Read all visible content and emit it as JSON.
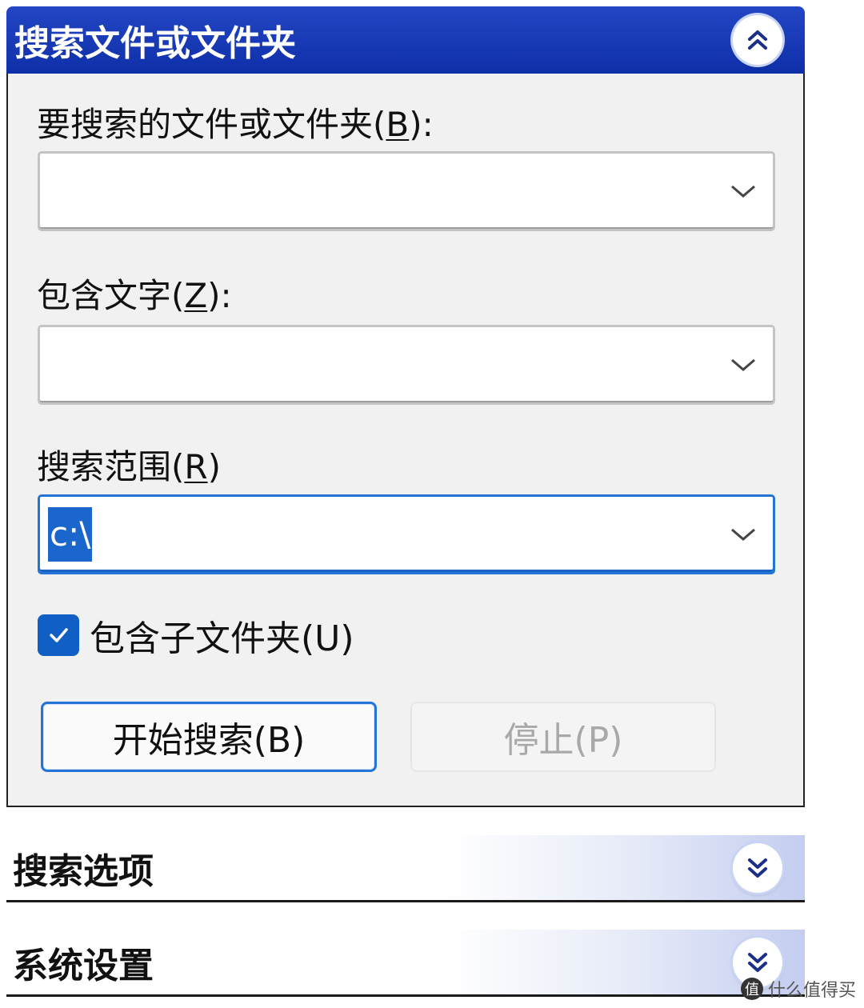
{
  "search_panel": {
    "title": "搜索文件或文件夹",
    "collapse_icon": "double-chevron-up-icon",
    "file_label": {
      "pre": "要搜索的文件或文件夹(",
      "key": "B",
      "post": "):"
    },
    "file_value": "",
    "text_label": {
      "pre": "包含文字(",
      "key": "Z",
      "post": "):"
    },
    "text_value": "",
    "scope_label": {
      "pre": "搜索范围(",
      "key": "R",
      "post": ")"
    },
    "scope_value": "c:\\",
    "subfolders_checked": true,
    "subfolders_label": "包含子文件夹(U)",
    "start_button": "开始搜索(B)",
    "stop_button": "停止(P)"
  },
  "options_panel": {
    "title": "搜索选项",
    "expand_icon": "double-chevron-down-icon"
  },
  "settings_panel": {
    "title": "系统设置",
    "expand_icon": "double-chevron-down-icon"
  },
  "watermark": {
    "text": "什么值得买",
    "badge": "值"
  },
  "colors": {
    "header_blue": "#0e2fa8",
    "focus_blue": "#2374d6",
    "checkbox_blue": "#0f5fc4",
    "panel_bg": "#f1f1f1",
    "disabled_text": "#a8a8a8"
  }
}
